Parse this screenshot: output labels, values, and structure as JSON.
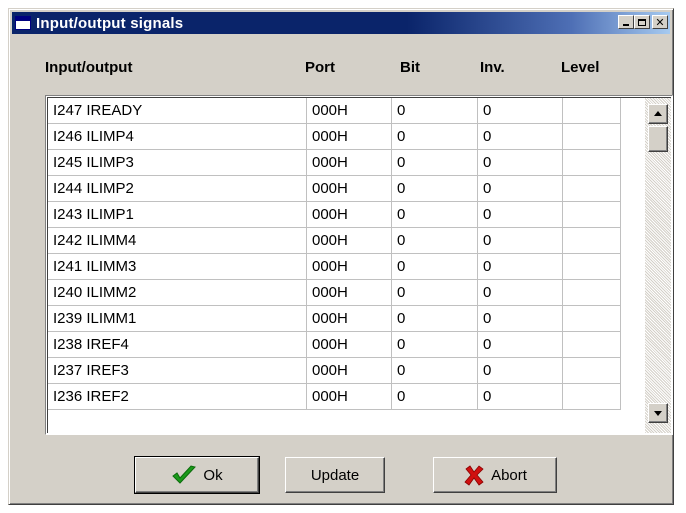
{
  "window": {
    "title": "Input/output signals"
  },
  "columns": {
    "io": "Input/output",
    "port": "Port",
    "bit": "Bit",
    "inv": "Inv.",
    "level": "Level"
  },
  "rows": [
    {
      "name": "I247 IREADY",
      "port": "000H",
      "bit": "0",
      "inv": "0",
      "level": ""
    },
    {
      "name": "I246 ILIMP4",
      "port": "000H",
      "bit": "0",
      "inv": "0",
      "level": ""
    },
    {
      "name": "I245 ILIMP3",
      "port": "000H",
      "bit": "0",
      "inv": "0",
      "level": ""
    },
    {
      "name": "I244 ILIMP2",
      "port": "000H",
      "bit": "0",
      "inv": "0",
      "level": ""
    },
    {
      "name": "I243 ILIMP1",
      "port": "000H",
      "bit": "0",
      "inv": "0",
      "level": ""
    },
    {
      "name": "I242 ILIMM4",
      "port": "000H",
      "bit": "0",
      "inv": "0",
      "level": ""
    },
    {
      "name": "I241 ILIMM3",
      "port": "000H",
      "bit": "0",
      "inv": "0",
      "level": ""
    },
    {
      "name": "I240 ILIMM2",
      "port": "000H",
      "bit": "0",
      "inv": "0",
      "level": ""
    },
    {
      "name": "I239 ILIMM1",
      "port": "000H",
      "bit": "0",
      "inv": "0",
      "level": ""
    },
    {
      "name": "I238 IREF4",
      "port": "000H",
      "bit": "0",
      "inv": "0",
      "level": ""
    },
    {
      "name": "I237 IREF3",
      "port": "000H",
      "bit": "0",
      "inv": "0",
      "level": ""
    },
    {
      "name": "I236 IREF2",
      "port": "000H",
      "bit": "0",
      "inv": "0",
      "level": ""
    }
  ],
  "buttons": {
    "ok": "Ok",
    "update": "Update",
    "abort": "Abort"
  },
  "colors": {
    "titlebar": "#0a246a",
    "face": "#d4d0c8",
    "ok_check": "#1a9a1a",
    "abort_x": "#d01010"
  },
  "icons": {
    "title": "window-icon",
    "minimize": "minimize-icon",
    "maximize": "maximize-icon",
    "close": "close-icon",
    "ok": "check-icon",
    "abort": "x-icon"
  }
}
